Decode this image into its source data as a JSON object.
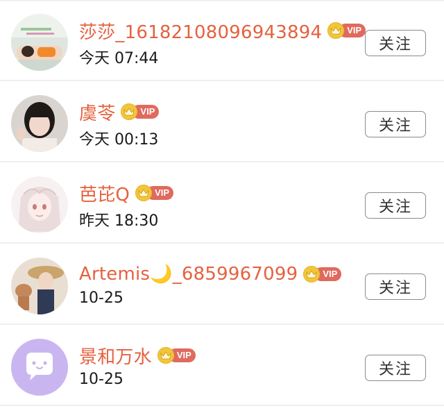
{
  "colors": {
    "name": "#e5613f",
    "vip_badge": "#e06a5e",
    "crown": "#f2c63a"
  },
  "vip_label": "VIP",
  "users": [
    {
      "name": "莎莎_16182108096943894",
      "time": "今天 07:44",
      "follow_label": "关注",
      "avatar": "avatar-photo-lying"
    },
    {
      "name": "虞苓",
      "time": "今天 00:13",
      "follow_label": "关注",
      "avatar": "avatar-photo-girl"
    },
    {
      "name": "芭芘Q",
      "time": "昨天 18:30",
      "follow_label": "关注",
      "avatar": "avatar-anime-girl"
    },
    {
      "name": "Artemis🌙_6859967099",
      "time": "10-25",
      "follow_label": "关注",
      "avatar": "avatar-photo-hat"
    },
    {
      "name": "景和万水",
      "time": "10-25",
      "follow_label": "关注",
      "avatar": "avatar-default-purple"
    }
  ]
}
